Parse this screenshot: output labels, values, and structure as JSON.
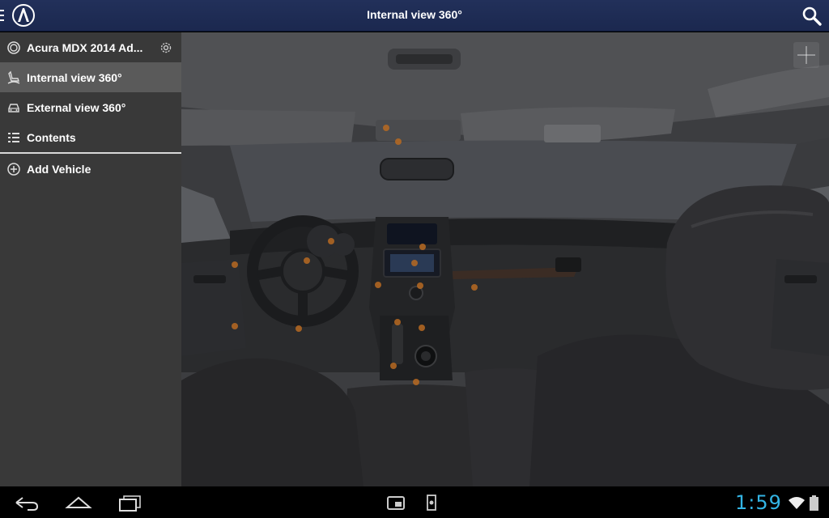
{
  "actionbar": {
    "title": "Internal view 360°",
    "logo_icon": "acura-logo-icon",
    "search_icon": "search-icon",
    "menu_icon": "drawer-indicator-icon"
  },
  "drawer": {
    "vehicle": {
      "label": "Acura MDX 2014 Ad...",
      "icon": "vehicle-radio-icon",
      "settings_icon": "gear-icon"
    },
    "items": [
      {
        "label": "Internal view 360°",
        "icon": "seat-icon",
        "active": true
      },
      {
        "label": "External view 360°",
        "icon": "car-icon",
        "active": false
      },
      {
        "label": "Contents",
        "icon": "list-icon",
        "active": false
      }
    ],
    "add_vehicle": {
      "label": "Add Vehicle",
      "icon": "plus-circle-icon"
    }
  },
  "view": {
    "zoom_icon": "plus-icon"
  },
  "sysbar": {
    "time": "1:59",
    "buttons": [
      "back-icon",
      "home-icon",
      "recents-icon"
    ],
    "notifications": [
      "screenshot-icon",
      "usb-icon"
    ],
    "status": [
      "wifi-icon",
      "battery-icon"
    ]
  },
  "colors": {
    "actionbar": "#1f2c55",
    "drawer": "#393939",
    "drawer_active": "#5a5a5a",
    "clock": "#33b5e5",
    "hotspot": "#b86a22"
  }
}
